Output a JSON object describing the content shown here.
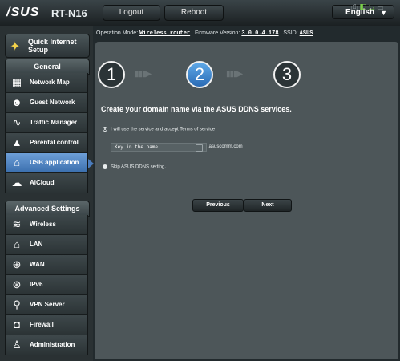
{
  "header": {
    "logo": "/SUS",
    "model": "RT-N16",
    "logout_label": "Logout",
    "reboot_label": "Reboot",
    "language": "English",
    "language_caret": "▼"
  },
  "info": {
    "mode_label": "Operation Mode:",
    "mode_value": "Wireless router",
    "firmware_label": "Firmware Version:",
    "firmware_value": "3.0.0.4.178",
    "ssid_label": "SSID:",
    "ssid_value": "ASUS"
  },
  "sidebar": {
    "quick_setup": "Quick Internet Setup",
    "general_title": "General",
    "general_items": [
      {
        "label": "Network Map",
        "icon": "network-map-icon",
        "glyph": "▦"
      },
      {
        "label": "Guest Network",
        "icon": "guest-network-icon",
        "glyph": "☻"
      },
      {
        "label": "Traffic Manager",
        "icon": "traffic-manager-icon",
        "glyph": "∿"
      },
      {
        "label": "Parental control",
        "icon": "lock-icon",
        "glyph": "▲"
      },
      {
        "label": "USB application",
        "icon": "usb-icon",
        "glyph": "⌂"
      },
      {
        "label": "AiCloud",
        "icon": "cloud-icon",
        "glyph": "☁"
      }
    ],
    "advanced_title": "Advanced Settings",
    "advanced_items": [
      {
        "label": "Wireless",
        "icon": "wireless-icon",
        "glyph": "≋"
      },
      {
        "label": "LAN",
        "icon": "lan-icon",
        "glyph": "⌂"
      },
      {
        "label": "WAN",
        "icon": "wan-icon",
        "glyph": "⊕"
      },
      {
        "label": "IPv6",
        "icon": "ipv6-icon",
        "glyph": "⊛"
      },
      {
        "label": "VPN Server",
        "icon": "vpn-icon",
        "glyph": "⚲"
      },
      {
        "label": "Firewall",
        "icon": "firewall-icon",
        "glyph": "◘"
      },
      {
        "label": "Administration",
        "icon": "admin-icon",
        "glyph": "♙"
      }
    ]
  },
  "steps": {
    "numbers": [
      "1",
      "2",
      "3"
    ],
    "current": 2
  },
  "ddns": {
    "heading": "Create your domain name via the ASUS DDNS services.",
    "option_accept": "I will use the service and accept Terms of service",
    "input_value": "Key in the name",
    "domain_suffix": ".asuscomm.com",
    "option_skip": "Skip ASUS DDNS setting.",
    "previous_label": "Previous",
    "next_label": "Next"
  },
  "colors": {
    "accent": "#3b6fae",
    "panel": "#4d5659",
    "status_green": "#7ad04a"
  }
}
